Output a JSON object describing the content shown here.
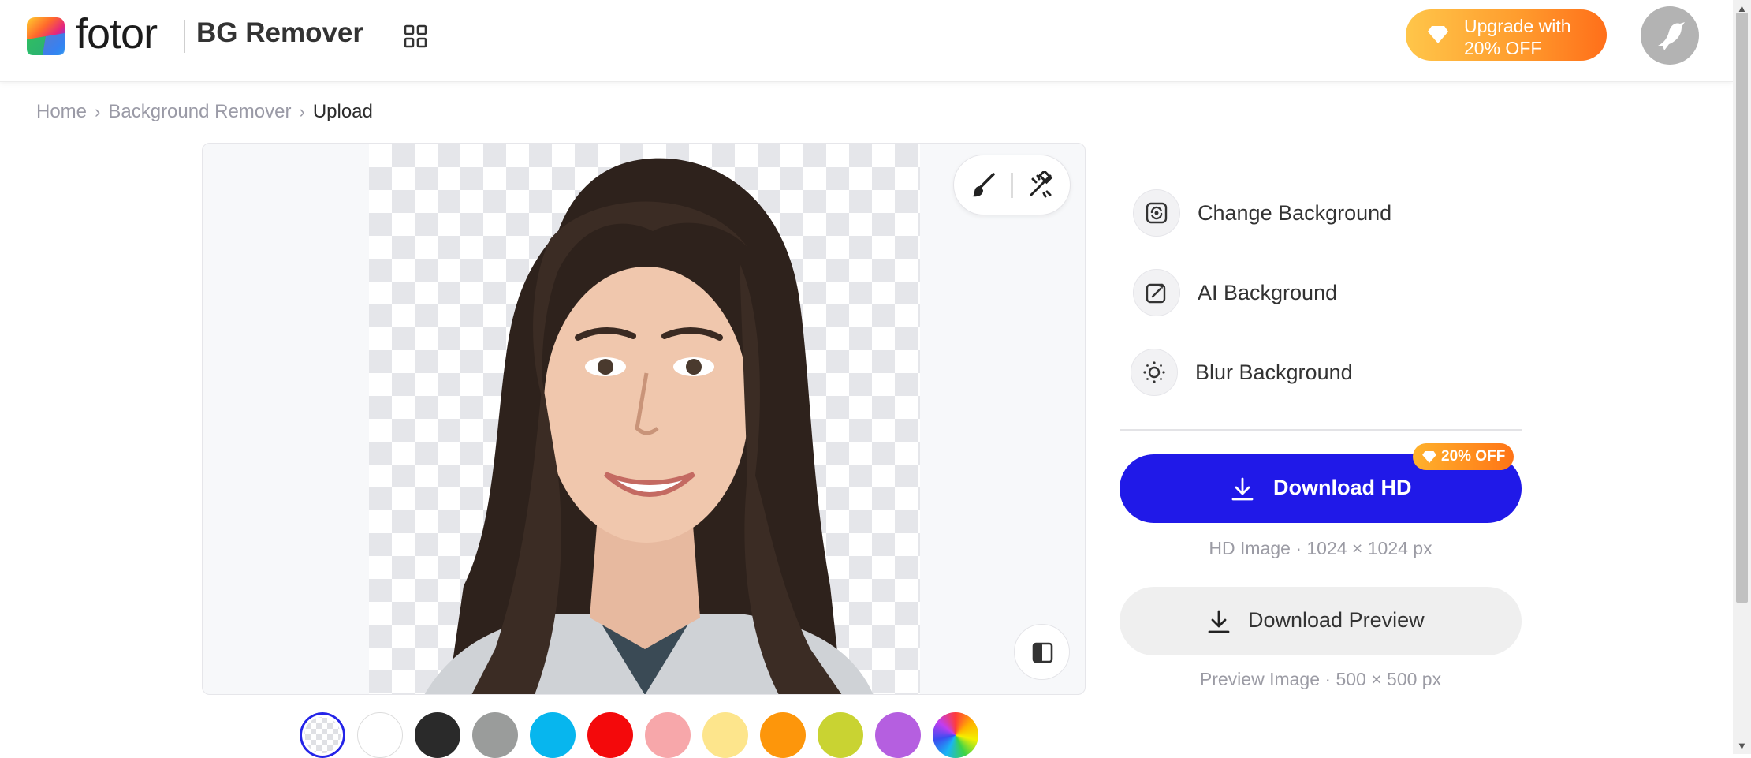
{
  "header": {
    "logo_text": "fotor",
    "product_name": "BG Remover",
    "upgrade_label": "Upgrade with 20% OFF",
    "icons": {
      "apps": "grid-icon",
      "upgrade": "diamond-icon",
      "avatar": "bird-avatar-icon"
    }
  },
  "breadcrumb": {
    "items": [
      "Home",
      "Background Remover"
    ],
    "current": "Upload"
  },
  "canvas": {
    "tools": [
      "brush-icon",
      "eraser-icon"
    ],
    "compare": "compare-icon"
  },
  "swatches": [
    {
      "name": "transparent",
      "color": "transparent",
      "selected": true
    },
    {
      "name": "white",
      "color": "#ffffff"
    },
    {
      "name": "black",
      "color": "#2a2a2a"
    },
    {
      "name": "gray",
      "color": "#9a9c9b"
    },
    {
      "name": "sky-blue",
      "color": "#07b6ee"
    },
    {
      "name": "red",
      "color": "#f4090b"
    },
    {
      "name": "pink",
      "color": "#f7a7aa"
    },
    {
      "name": "yellow",
      "color": "#fde58c"
    },
    {
      "name": "orange",
      "color": "#fd960b"
    },
    {
      "name": "lime",
      "color": "#c9d332"
    },
    {
      "name": "purple",
      "color": "#b55fe0"
    },
    {
      "name": "custom",
      "color": "conic"
    }
  ],
  "panel": {
    "options": [
      {
        "label": "Change Background",
        "icon": "change-background-icon"
      },
      {
        "label": "AI Background",
        "icon": "ai-background-icon"
      },
      {
        "label": "Blur Background",
        "icon": "blur-background-icon"
      }
    ],
    "download_hd": {
      "label": "Download HD",
      "badge": "20% OFF",
      "info": "HD Image · 1024 × 1024 px"
    },
    "download_preview": {
      "label": "Download Preview",
      "info": "Preview Image · 500 × 500 px"
    }
  },
  "colors": {
    "primary": "#2019e8",
    "accent": "#ff8a1f"
  }
}
